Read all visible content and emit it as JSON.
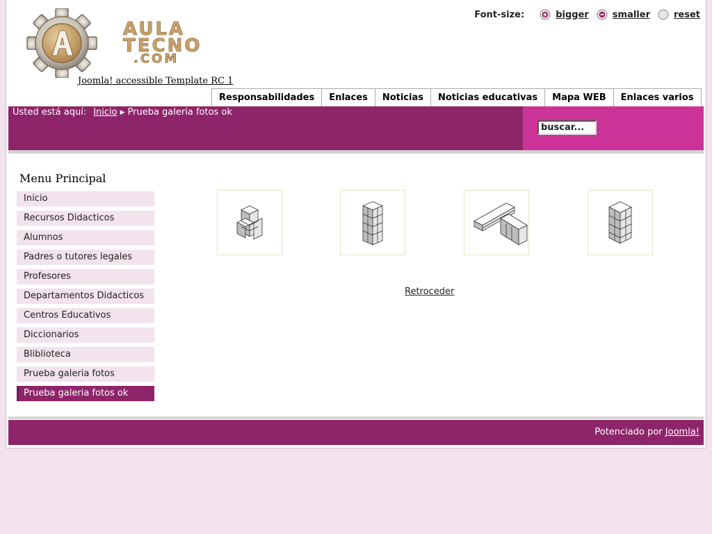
{
  "header": {
    "logo_text": "AULA TECNO .COM",
    "site_title": "Joomla! accessible Template RC 1"
  },
  "font_size": {
    "label": "Font-size:",
    "bigger": "bigger",
    "smaller": "smaller",
    "reset": "reset"
  },
  "top_nav": {
    "items": [
      "Responsabilidades",
      "Enlaces",
      "Noticias",
      "Noticias educativas",
      "Mapa WEB",
      "Enlaces varios"
    ]
  },
  "breadcrumb": {
    "prefix": "Usted está aquí:",
    "home": "Inicio",
    "current": "Prueba galeria fotos ok"
  },
  "search": {
    "placeholder": "buscar..."
  },
  "sidebar": {
    "title": "Menu Principal",
    "items": [
      "Inicio",
      "Recursos Didacticos",
      "Alumnos",
      "Padres o tutores legales",
      "Profesores",
      "Departamentos Didacticos",
      "Centros Educativos",
      "Diccionarios",
      "Bliblioteca",
      "Prueba galeria fotos",
      "Prueba galeria fotos ok"
    ],
    "active_index": 10
  },
  "gallery": {
    "thumbnail_count": 4,
    "back_label": "Retroceder"
  },
  "footer": {
    "text": "Potenciado por",
    "link": "Joomla!"
  },
  "colors": {
    "band": "#8e2469",
    "search_band": "#cc3399",
    "menu_bg": "#f3e3ed",
    "logo_gold": "#c8a06a"
  }
}
